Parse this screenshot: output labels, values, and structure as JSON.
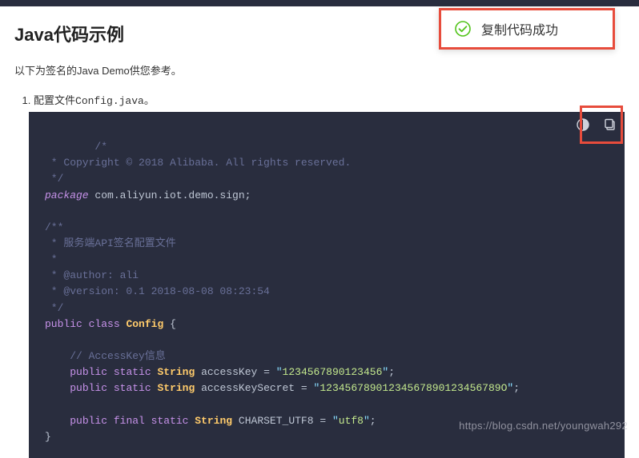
{
  "heading": "Java代码示例",
  "intro": "以下为签名的Java Demo供您参考。",
  "list_item_prefix": "配置文件",
  "list_item_file": "Config.java",
  "list_item_suffix": "。",
  "toast": {
    "text": "复制代码成功"
  },
  "code": {
    "c1_l1": "/*",
    "c1_l2": " * Copyright © 2018 Alibaba. All rights reserved.",
    "c1_l3": " */",
    "pkg_kw": "package",
    "pkg_name": " com.aliyun.iot.demo.sign",
    "semi": ";",
    "c2_l1": "/**",
    "c2_l2": " * 服务端API签名配置文件",
    "c2_l3": " *",
    "c2_l4": " * @author: ali",
    "c2_l5": " * @version: 0.1 2018-08-08 08:23:54",
    "c2_l6": " */",
    "pub": "public",
    "cls": "class",
    "cls_name": "Config",
    "brace_o": " {",
    "brace_c": "}",
    "c3": "// AccessKey信息",
    "static": "static",
    "final": "final",
    "string": "String",
    "ak_var": " accessKey ",
    "eq": "=",
    "q": "\"",
    "ak_val": "1234567890123456",
    "aks_var": " accessKeySecret ",
    "aks_val": "12345678901234567890123456789O",
    "cs_var": " CHARSET_UTF8 ",
    "cs_val": "utf8"
  },
  "watermark": "https://blog.csdn.net/youngwah292"
}
